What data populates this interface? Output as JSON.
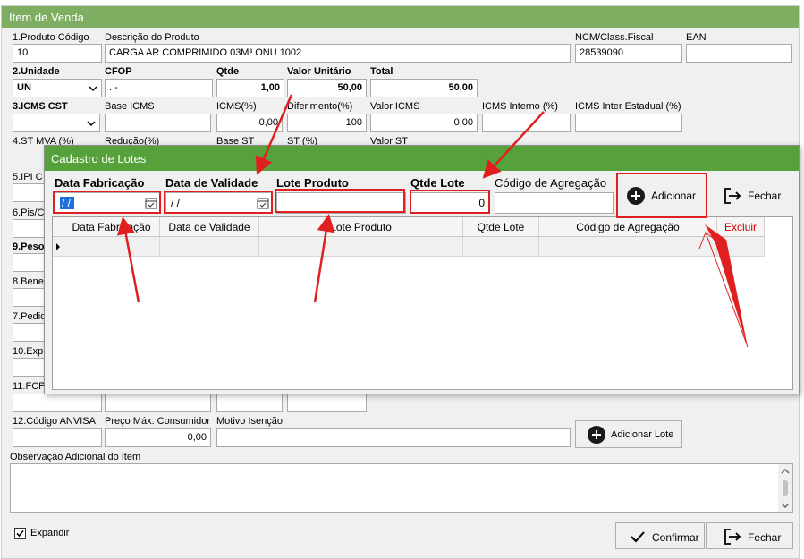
{
  "window": {
    "title": "Item de Venda"
  },
  "form": {
    "produto_codigo": {
      "label": "1.Produto Código",
      "value": "10"
    },
    "descricao": {
      "label": "Descrição do Produto",
      "value": "CARGA AR COMPRIMIDO 03M³ ONU 1002"
    },
    "ncm": {
      "label": "NCM/Class.Fiscal",
      "value": "28539090"
    },
    "ean": {
      "label": "EAN",
      "value": ""
    },
    "unidade": {
      "label": "2.Unidade",
      "value": "UN"
    },
    "cfop": {
      "label": "CFOP",
      "value": " .  -"
    },
    "qtde": {
      "label": "Qtde",
      "value": "1,00"
    },
    "valor_unitario": {
      "label": "Valor Unitário",
      "value": "50,00"
    },
    "total": {
      "label": "Total",
      "value": "50,00"
    },
    "icms_cst": {
      "label": "3.ICMS CST",
      "value": ""
    },
    "base_icms": {
      "label": "Base ICMS",
      "value": ""
    },
    "icms_pct": {
      "label": "ICMS(%)",
      "value": "0,00"
    },
    "diferimento": {
      "label": "Diferimento(%)",
      "value": "100"
    },
    "valor_icms": {
      "label": "Valor ICMS",
      "value": "0,00"
    },
    "icms_interno": {
      "label": "ICMS Interno (%)",
      "value": ""
    },
    "icms_inter": {
      "label": "ICMS Inter Estadual (%)",
      "value": ""
    },
    "st_mva": {
      "label": "4.ST MVA (%)"
    },
    "reducao": {
      "label": "Redução(%)"
    },
    "base_st": {
      "label": "Base ST"
    },
    "st_pct": {
      "label": "ST (%)"
    },
    "valor_st": {
      "label": "Valor ST"
    },
    "sec5": "5.IPI C",
    "sec6": "6.Pis/C",
    "sec9": "9.Peso",
    "sec8": "8.Bene",
    "sec7": "7.Pedid",
    "sec10": "10.Exp",
    "sec11": "11.FCP",
    "codigo_anvisa": {
      "label": "12.Código ANVISA",
      "value": ""
    },
    "preco_max": {
      "label": "Preço Máx. Consumidor",
      "value": "0,00"
    },
    "motivo_isencao": {
      "label": "Motivo Isenção",
      "value": ""
    },
    "adicionar_lote": "Adicionar Lote",
    "observacao": {
      "label": "Observação Adicional do Item",
      "value": ""
    },
    "expandir": {
      "label": "Expandir",
      "checked": true
    },
    "confirmar": "Confirmar",
    "fechar": "Fechar"
  },
  "modal": {
    "title": "Cadastro de Lotes",
    "data_fabricacao": {
      "label": "Data Fabricação",
      "value": " / /"
    },
    "data_validade": {
      "label": "Data de Validade",
      "value": " / /"
    },
    "lote_produto": {
      "label": "Lote Produto",
      "value": ""
    },
    "qtde_lote": {
      "label": "Qtde Lote",
      "value": "0"
    },
    "codigo_agregacao": {
      "label": "Código de Agregação",
      "value": ""
    },
    "adicionar": "Adicionar",
    "fechar": "Fechar",
    "grid": {
      "columns": [
        "Data Fabricação",
        "Data de Validade",
        "Lote Produto",
        "Qtde Lote",
        "Código de Agregação",
        "Excluir"
      ]
    }
  },
  "colors": {
    "titlebar": "#7fae63",
    "modal_titlebar": "#56a13a",
    "highlight": "#e02020",
    "excluir": "#d00000"
  },
  "icons": [
    "chevron-down-icon",
    "calendar-icon",
    "plus-circle-icon",
    "exit-icon",
    "check-icon",
    "row-pointer-icon"
  ]
}
